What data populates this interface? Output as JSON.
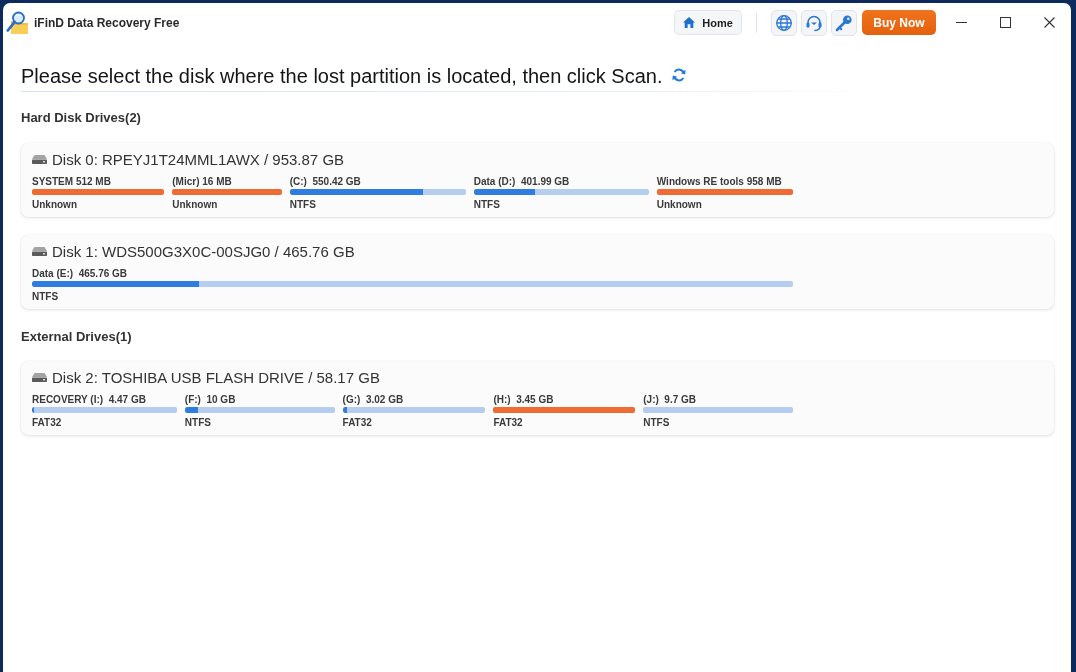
{
  "window": {
    "title": "iFinD Data Recovery Free"
  },
  "toolbar": {
    "home": "Home",
    "buy": "Buy Now"
  },
  "instruction": "Please select the disk where the lost partition is located, then click Scan.",
  "sections": [
    {
      "title": "Hard Disk Drives(2)",
      "disks": [
        {
          "name": "Disk 0: RPEYJ1T24MML1AWX / 953.87 GB",
          "partitions": [
            {
              "label": "SYSTEM 512 MB",
              "filesystem": "Unknown",
              "color": "#ee6b33"
            },
            {
              "label": "(Micr) 16 MB",
              "filesystem": "Unknown",
              "color": "#ee6b33"
            },
            {
              "label": "(C:)  550.42 GB",
              "filesystem": "NTFS",
              "level": 0.76,
              "color": "#2f7de1"
            },
            {
              "label": "Data (D:)  401.99 GB",
              "filesystem": "NTFS",
              "level": 0.35,
              "color": "#2f7de1"
            },
            {
              "label": "Windows RE tools 958 MB",
              "filesystem": "Unknown",
              "color": "#ee6b33"
            }
          ]
        },
        {
          "name": "Disk 1: WDS500G3X0C-00SJG0 / 465.76 GB",
          "partitions": [
            {
              "label": "Data (E:)  465.76 GB",
              "filesystem": "NTFS",
              "level": 0.22,
              "color": "#2f7de1"
            }
          ]
        }
      ]
    },
    {
      "title": "External Drives(1)",
      "disks": [
        {
          "name": "Disk 2: TOSHIBA USB FLASH DRIVE / 58.17 GB",
          "partitions": [
            {
              "label": "RECOVERY (I:)  4.47 GB",
              "filesystem": "FAT32",
              "level": 0.015,
              "color": "#2f7de1"
            },
            {
              "label": "(F:)  10 GB",
              "filesystem": "NTFS",
              "level": 0.09,
              "color": "#2f7de1"
            },
            {
              "label": "(G:)  3.02 GB",
              "filesystem": "FAT32",
              "level": 0.03,
              "color": "#2f7de1"
            },
            {
              "label": "(H:)  3.45 GB",
              "filesystem": "FAT32",
              "color": "#ee6b33"
            },
            {
              "label": "(J:)  9.7 GB",
              "filesystem": "NTFS"
            }
          ]
        }
      ]
    }
  ]
}
